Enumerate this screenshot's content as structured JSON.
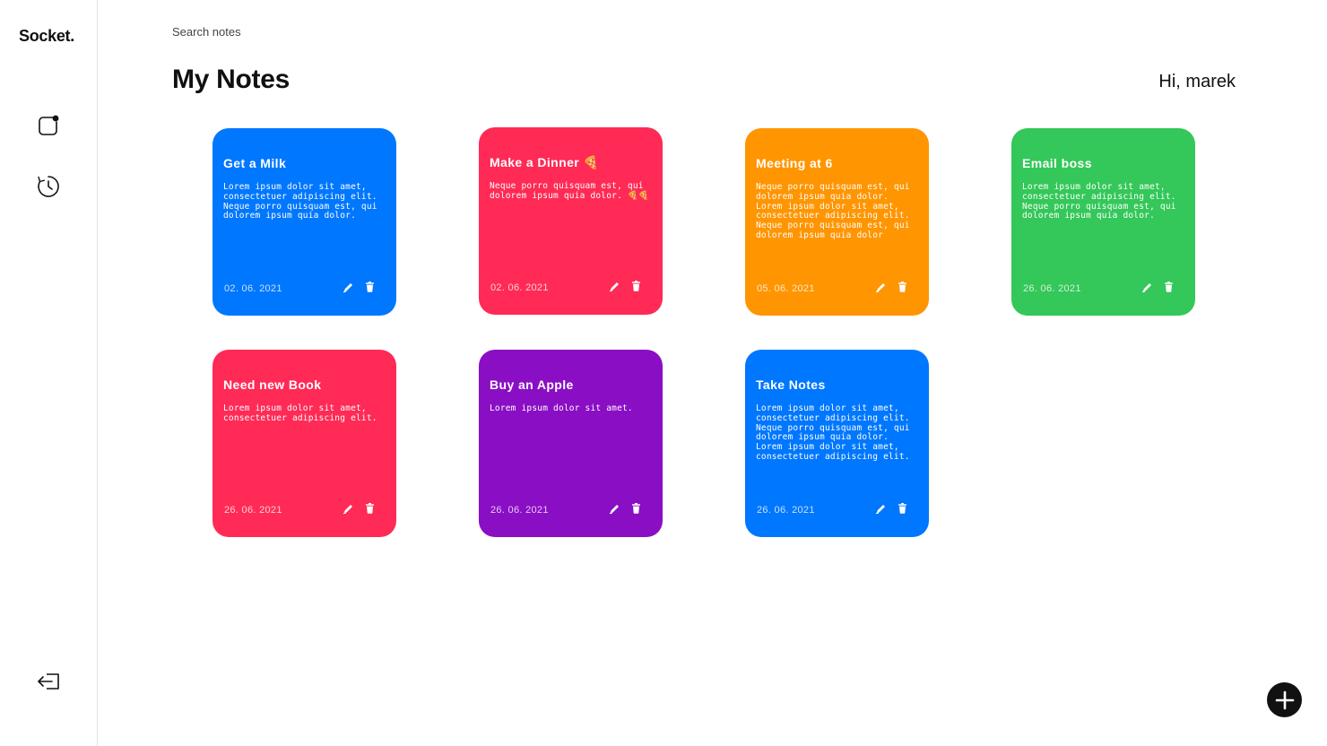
{
  "app": {
    "logo": "Socket."
  },
  "sidebar": {
    "icons": [
      "new-note-icon",
      "history-icon",
      "logout-icon"
    ]
  },
  "search": {
    "placeholder": "Search notes",
    "value": ""
  },
  "header": {
    "title": "My Notes",
    "greeting": "Hi, marek"
  },
  "notes": [
    {
      "title": "Get a Milk",
      "body": "Lorem ipsum dolor sit amet, consectetuer adipiscing elit. Neque porro quisquam est, qui dolorem ipsum quia dolor.",
      "date": "02. 06. 2021",
      "color": "#0077ff"
    },
    {
      "title": "Make a Dinner 🍕",
      "body": "Neque porro quisquam est, qui dolorem ipsum quia dolor. 🍕🍕",
      "date": "02. 06. 2021",
      "color": "#ff2a55"
    },
    {
      "title": "Meeting at 6",
      "body": "Neque porro quisquam est, qui dolorem ipsum quia dolor. Lorem ipsum dolor sit amet, consectetuer adipiscing elit. Neque porro quisquam est, qui dolorem ipsum quia dolor",
      "date": "05. 06. 2021",
      "color": "#ff9500"
    },
    {
      "title": "Email boss",
      "body": "Lorem ipsum dolor sit amet, consectetuer adipiscing elit. Neque porro quisquam est, qui dolorem ipsum quia dolor.",
      "date": "26. 06. 2021",
      "color": "#34c759"
    },
    {
      "title": "Need new Book",
      "body": "Lorem ipsum dolor sit amet, consectetuer adipiscing elit.",
      "date": "26. 06. 2021",
      "color": "#ff2a55"
    },
    {
      "title": "Buy an Apple",
      "body": "Lorem ipsum dolor sit amet.",
      "date": "26. 06. 2021",
      "color": "#8a0ec4"
    },
    {
      "title": "Take Notes",
      "body": "Lorem ipsum dolor sit amet, consectetuer adipiscing elit. Neque porro quisquam est, qui dolorem ipsum quia dolor. Lorem ipsum dolor sit amet, consectetuer adipiscing elit.",
      "date": "26. 06. 2021",
      "color": "#0077ff"
    }
  ],
  "fab": {
    "icon": "plus-icon"
  }
}
